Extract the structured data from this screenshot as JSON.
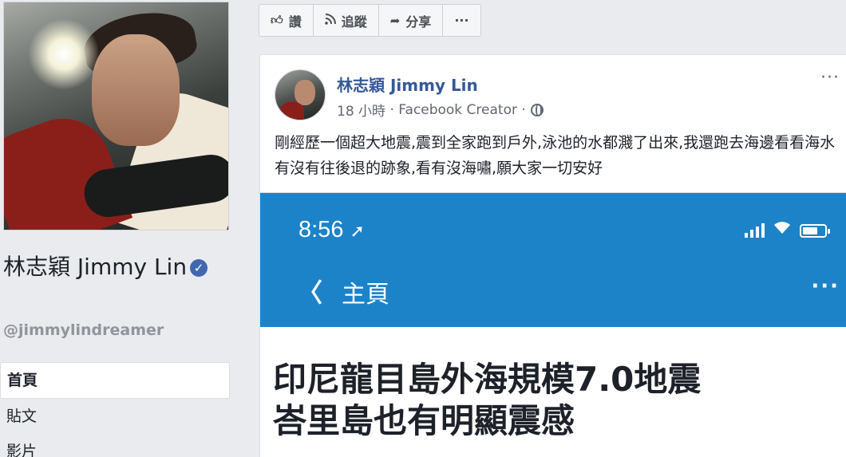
{
  "sidebar": {
    "page_name": "林志穎 Jimmy Lin",
    "handle": "@jimmylindreamer",
    "nav": [
      {
        "label": "首頁"
      },
      {
        "label": "貼文"
      },
      {
        "label": "影片"
      }
    ]
  },
  "actions": {
    "like": "讚",
    "follow": "追蹤",
    "share": "分享",
    "more": "···"
  },
  "post": {
    "author": "林志穎 Jimmy Lin",
    "time": "18 小時",
    "source": "Facebook Creator",
    "text": "剛經歷一個超大地震,震到全家跑到戶外,泳池的水都濺了出來,我還跑去海邊看看海水有沒有往後退的跡象,看有沒海嘯,願大家一切安好",
    "more": "···"
  },
  "screenshot": {
    "time": "8:56",
    "back": "〈",
    "nav_title": "主頁",
    "more": "···",
    "headline_line1": "印尼龍目島外海規模7.0地震",
    "headline_line2": "峇里島也有明顯震感"
  },
  "colors": {
    "link": "#365899",
    "app_blue": "#1c83c9",
    "verified": "#4267b2",
    "page_bg": "#e9ebee"
  },
  "icons": [
    "verified-icon",
    "like-icon",
    "rss-icon",
    "share-icon",
    "globe-icon",
    "location-arrow-icon",
    "signal-icon",
    "wifi-icon",
    "battery-icon"
  ]
}
